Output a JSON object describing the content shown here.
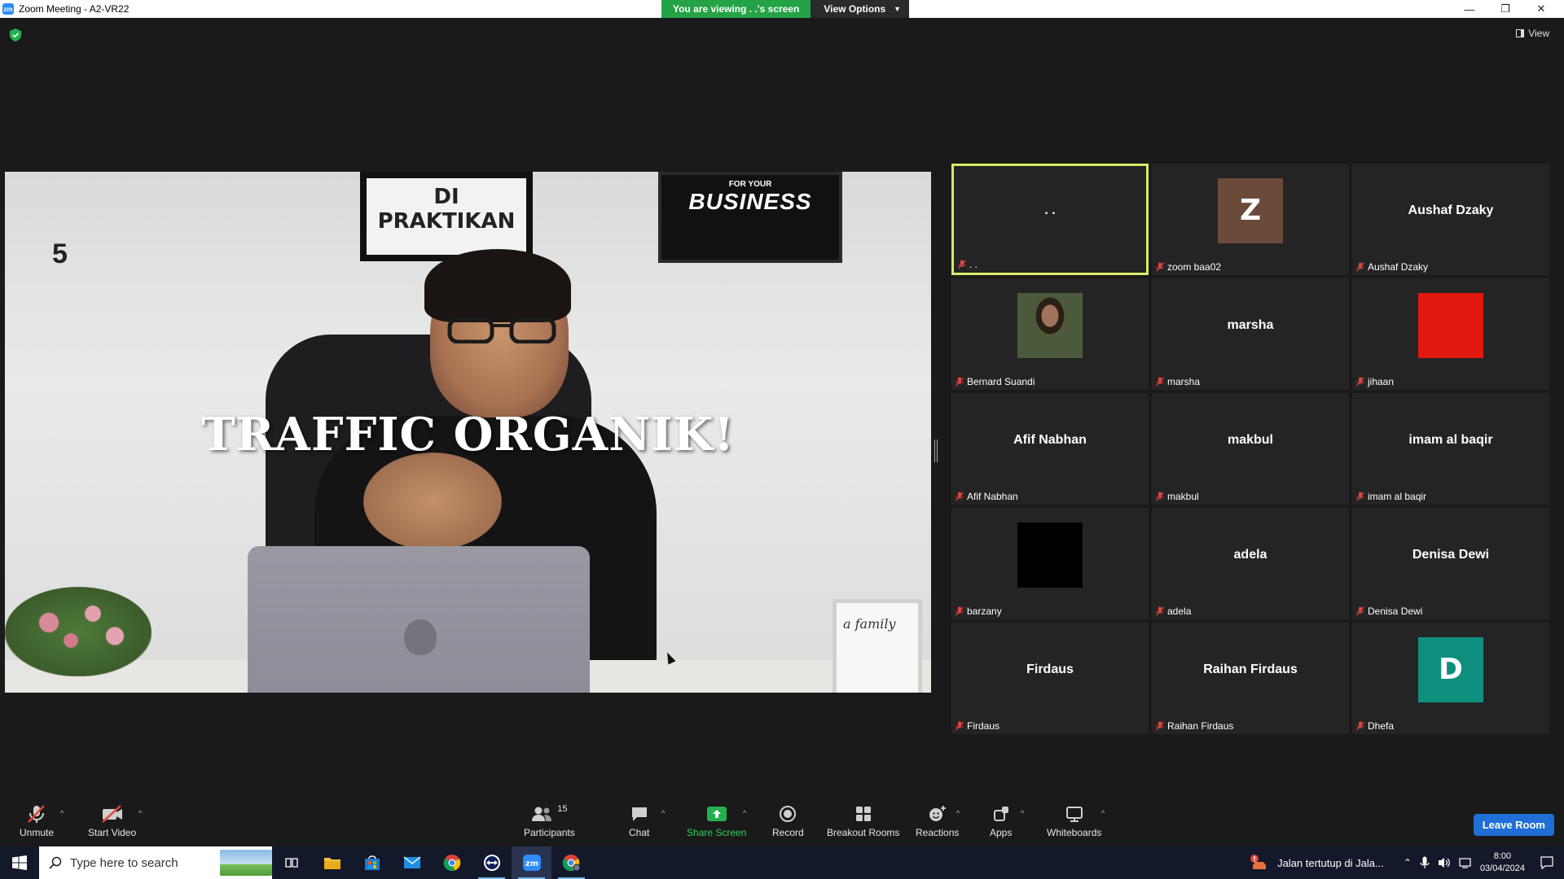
{
  "window": {
    "title": "Zoom Meeting - A2-VR22",
    "app_icon": "zm"
  },
  "banner": {
    "viewing_text": "You are viewing . .'s screen",
    "view_options_label": "View Options"
  },
  "top_right": {
    "view_label": "View"
  },
  "shared_screen": {
    "counter": "5",
    "caption": "TRAFFIC ORGANIK!",
    "frame_left_text": "DI PRAKTIKAN",
    "frame_right_small": "FOR YOUR",
    "frame_right_big": "BUSINESS",
    "sign_text": "a family"
  },
  "participants_grid": [
    {
      "display": ". .",
      "name": ". .",
      "type": "text",
      "active": true
    },
    {
      "display": "Z",
      "name": "zoom baa02",
      "type": "avatar",
      "avatar_color": "#6b4a3a"
    },
    {
      "display": "Aushaf Dzaky",
      "name": "Aushaf Dzaky",
      "type": "text"
    },
    {
      "display": "",
      "name": "Bernard Suandi",
      "type": "photo"
    },
    {
      "display": "marsha",
      "name": "marsha",
      "type": "text"
    },
    {
      "display": "",
      "name": "jihaan",
      "type": "avatar",
      "avatar_color": "#e0180e"
    },
    {
      "display": "Afif Nabhan",
      "name": "Afif Nabhan",
      "type": "text"
    },
    {
      "display": "makbul",
      "name": "makbul",
      "type": "text"
    },
    {
      "display": "imam al baqir",
      "name": "imam al baqir",
      "type": "text"
    },
    {
      "display": "",
      "name": "barzany",
      "type": "avatar",
      "avatar_color": "#000000"
    },
    {
      "display": "adela",
      "name": "adela",
      "type": "text"
    },
    {
      "display": "Denisa Dewi",
      "name": "Denisa Dewi",
      "type": "text"
    },
    {
      "display": "Firdaus",
      "name": "Firdaus",
      "type": "text"
    },
    {
      "display": "Raihan Firdaus",
      "name": "Raihan Firdaus",
      "type": "text"
    },
    {
      "display": "D",
      "name": "Dhefa",
      "type": "avatar",
      "avatar_color": "#0e8f7e"
    }
  ],
  "toolbar": {
    "unmute_label": "Unmute",
    "start_video_label": "Start Video",
    "participants_label": "Participants",
    "participants_count": "15",
    "chat_label": "Chat",
    "share_screen_label": "Share Screen",
    "record_label": "Record",
    "breakout_label": "Breakout Rooms",
    "reactions_label": "Reactions",
    "apps_label": "Apps",
    "whiteboards_label": "Whiteboards",
    "leave_label": "Leave Room"
  },
  "taskbar": {
    "search_placeholder": "Type here to search",
    "notification_text": "Jalan tertutup di Jala...",
    "time": "8:00",
    "date": "03/04/2024"
  },
  "colors": {
    "accent_green": "#23a346",
    "active_border": "#d9e96a",
    "leave_blue": "#1f6fd6",
    "muted_red": "#e0463c"
  }
}
